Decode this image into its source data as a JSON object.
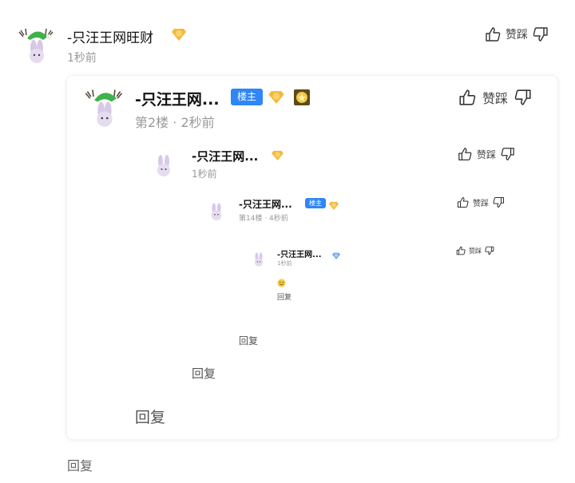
{
  "main_comment": {
    "username": "-只汪王网旺财",
    "time": "1秒前",
    "actions_label": "赞踩",
    "reply": "回复"
  },
  "level1_reply": {
    "username": "-只汪王网...",
    "badge": "楼主",
    "meta": "第2楼 · 2秒前",
    "actions_label": "赞踩",
    "reply": "回复"
  },
  "level2_reply": {
    "username": "-只汪王网...",
    "time": "1秒前",
    "actions_label": "赞踩",
    "reply": "回复"
  },
  "level3_reply": {
    "username": "-只汪王网...",
    "badge": "楼主",
    "meta": "第14楼 · 4秒前",
    "actions_label": "赞踩",
    "reply": "回复"
  },
  "level4_reply": {
    "username": "-只汪王网...",
    "time": "1秒前",
    "actions_label": "赞踩",
    "reply": "回复"
  },
  "colors": {
    "badge_blue": "#2f86f6",
    "gem_gold": "#f4b93b",
    "gem_blue": "#6fa8f5",
    "muted": "#999999"
  }
}
